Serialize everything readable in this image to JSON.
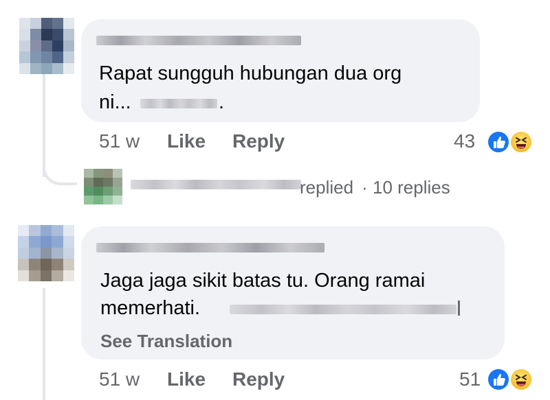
{
  "comments": [
    {
      "text_line1": "Rapat sungguh hubungan dua org",
      "text_line2": "ni...",
      "trailing_dot": ".",
      "time": "51 w",
      "like_label": "Like",
      "reply_label": "Reply",
      "reaction_count": "43",
      "reactions": [
        "like-icon",
        "haha-icon"
      ]
    },
    {
      "text_line1": "Jaga jaga sikit batas tu. Orang ramai",
      "text_line2": "memerhati.",
      "see_translation": "See Translation",
      "time": "51 w",
      "like_label": "Like",
      "reply_label": "Reply",
      "reaction_count": "51",
      "reactions": [
        "like-icon",
        "haha-icon"
      ]
    }
  ],
  "reply_summary": {
    "replied_text": "replied",
    "separator": "·",
    "replies_count": "10 replies"
  },
  "colors": {
    "bubble": "#f0f2f5",
    "meta_text": "#65676b",
    "like_blue": "#1877f2",
    "haha_yellow": "#f7c031",
    "thread_line": "#e4e6eb"
  }
}
